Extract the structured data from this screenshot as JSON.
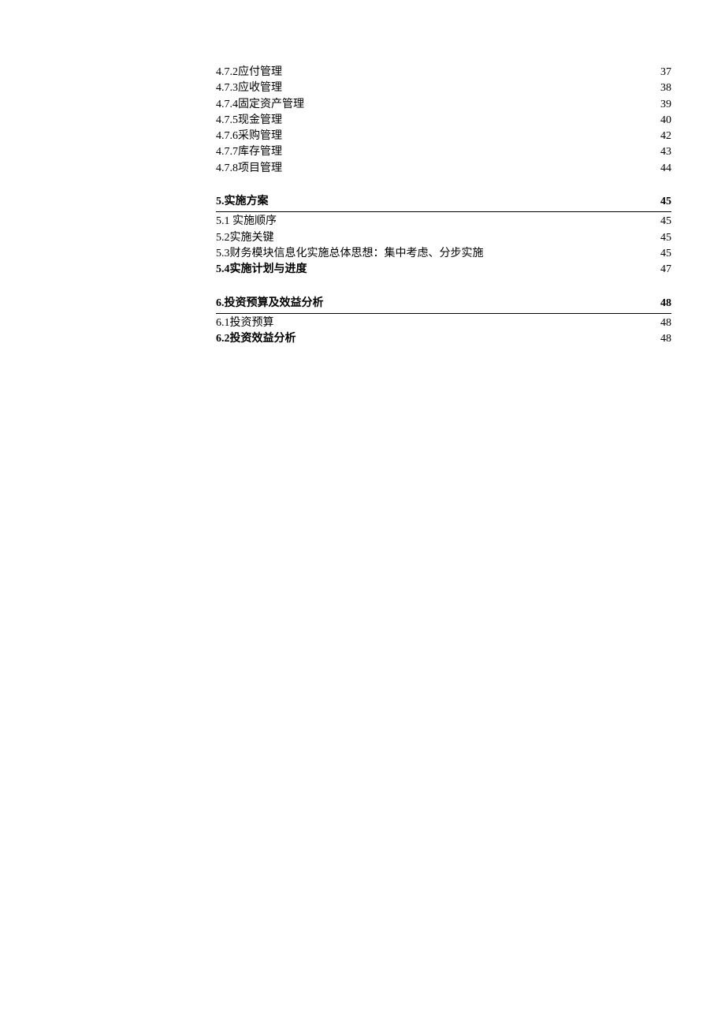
{
  "toc": {
    "groups": [
      {
        "entries": [
          {
            "label": "4.7.2应付管理",
            "page": "37",
            "bold": false
          },
          {
            "label": "4.7.3应收管理",
            "page": "38",
            "bold": false
          },
          {
            "label": "4.7.4固定资产管理",
            "page": "39",
            "bold": false
          },
          {
            "label": "4.7.5现金管理",
            "page": "40",
            "bold": false
          },
          {
            "label": "4.7.6采购管理",
            "page": "42",
            "bold": false
          },
          {
            "label": "4.7.7库存管理",
            "page": "43",
            "bold": false
          },
          {
            "label": "4.7.8项目管理",
            "page": "44",
            "bold": false
          }
        ]
      },
      {
        "heading": {
          "label": "5.实施方案",
          "page": "45",
          "bold": true
        },
        "entries": [
          {
            "label": "5.1  实施顺序",
            "page": "45",
            "bold": false
          },
          {
            "label": "5.2实施关键",
            "page": "45",
            "bold": false
          },
          {
            "label": "5.3财务模块信息化实施总体思想：集中考虑、分步实施",
            "page": "45",
            "bold": false
          },
          {
            "label": "5.4实施计划与进度",
            "page": "47",
            "bold": true
          }
        ]
      },
      {
        "heading": {
          "label": "6.投资预算及效益分析",
          "page": "48",
          "bold": true
        },
        "entries": [
          {
            "label": "6.1投资预算",
            "page": "48",
            "bold": false
          },
          {
            "label": "6.2投资效益分析",
            "page": "48",
            "bold": true
          }
        ]
      }
    ]
  }
}
